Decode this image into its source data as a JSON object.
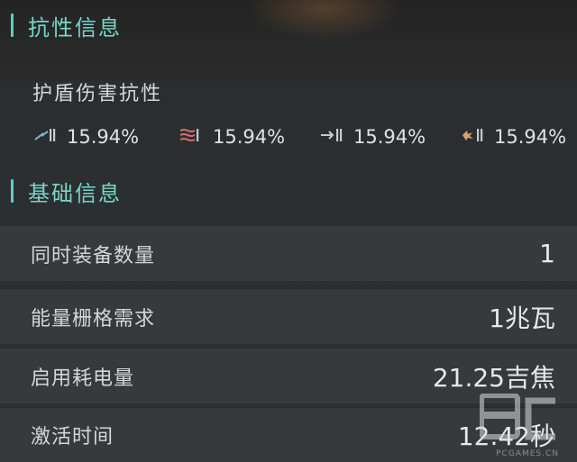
{
  "sections": {
    "resistance": {
      "title": "抗性信息"
    },
    "basic": {
      "title": "基础信息"
    }
  },
  "resistance": {
    "subtitle": "护盾伤害抗性",
    "items": [
      {
        "icon": "electric-damage-icon",
        "value": "15.94%",
        "color": "#7fb6d8"
      },
      {
        "icon": "fire-damage-icon",
        "value": "15.94%",
        "color": "#d8706a"
      },
      {
        "icon": "kinetic-damage-icon",
        "value": "15.94%",
        "color": "#c7cbcf"
      },
      {
        "icon": "explosive-damage-icon",
        "value": "15.94%",
        "color": "#d4a36a"
      }
    ]
  },
  "basic_info": {
    "rows": [
      {
        "label": "同时装备数量",
        "value": "1"
      },
      {
        "label": "能量栅格需求",
        "value": "1兆瓦"
      },
      {
        "label": "启用耗电量",
        "value": "21.25吉焦"
      },
      {
        "label": "激活时间",
        "value": "12.42秒"
      }
    ]
  },
  "colors": {
    "accent": "#5ecfc1",
    "background": "#2b2d2f",
    "row_background": "#363a3d"
  },
  "watermark": {
    "logo": "PC",
    "text": "PCGAMES.CN"
  }
}
